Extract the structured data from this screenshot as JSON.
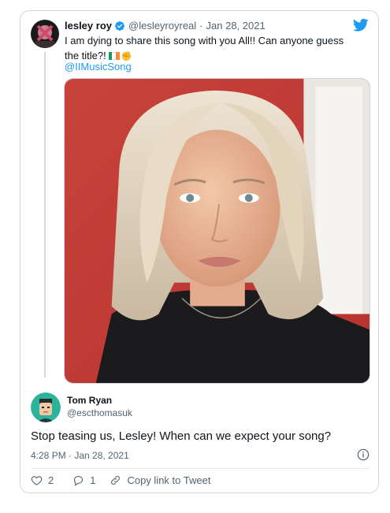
{
  "quoted_tweet": {
    "author_name": "lesley roy",
    "author_handle": "@lesleyroyreal",
    "separator": "·",
    "date": "Jan 28, 2021",
    "text": "I am dying to share this song with you All!! Can anyone guess the title?!",
    "mention": "@IIMusicSong",
    "icons": [
      "verified-badge-icon",
      "twitter-bird-icon",
      "ireland-flag-icon",
      "hand-icon"
    ]
  },
  "reply": {
    "author_name": "Tom Ryan",
    "author_handle": "@escthomasuk",
    "text": "Stop teasing us, Lesley! When can we expect your song?",
    "timestamp": "4:28 PM · Jan 28, 2021"
  },
  "actions": {
    "like_count": "2",
    "reply_count": "1",
    "copy_link_label": "Copy link to Tweet"
  },
  "colors": {
    "link": "#1d9bf0",
    "secondary_text": "#536471",
    "border": "#cfd9de"
  }
}
